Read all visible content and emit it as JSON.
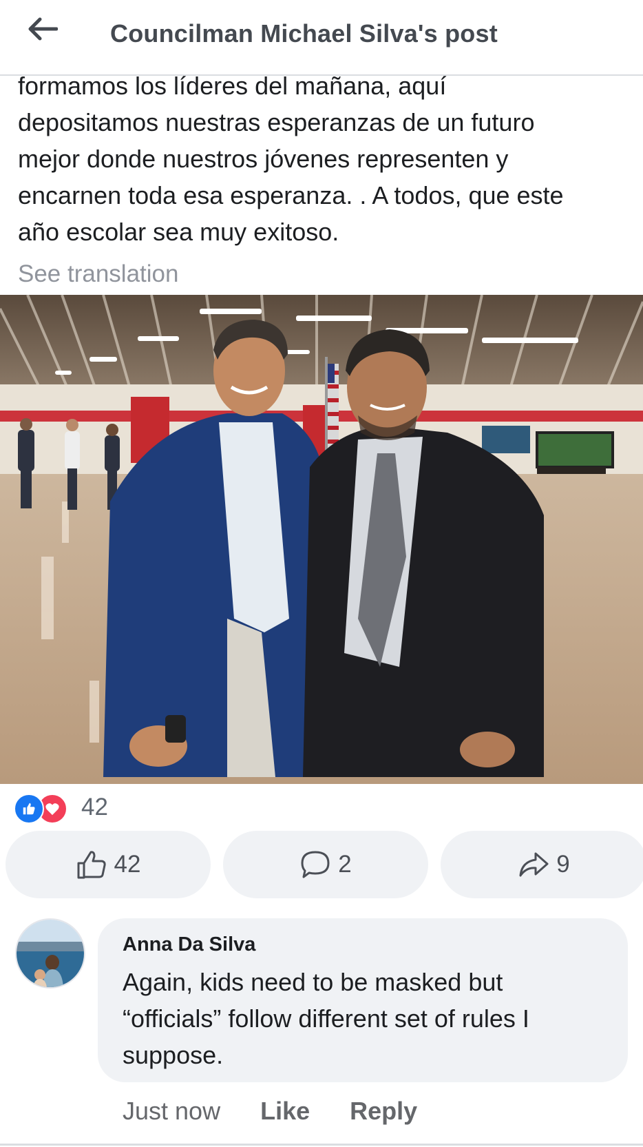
{
  "header": {
    "title": "Councilman Michael Silva's post",
    "back_icon": "arrow-left-icon"
  },
  "post": {
    "text_lines": [
      "formamos los líderes del mañana, aquí",
      "depositamos nuestras esperanzas de un futuro",
      "mejor donde nuestros jóvenes representen y",
      "encarnen toda esa esperanza. . A todos, que este",
      "año escolar sea muy exitoso."
    ],
    "see_translation": "See translation"
  },
  "reactions": {
    "icons": [
      "like-icon",
      "love-icon"
    ],
    "count": "42"
  },
  "actions": {
    "like_count": "42",
    "comment_count": "2",
    "share_count": "9"
  },
  "comment": {
    "author": "Anna Da Silva",
    "text_lines": [
      "Again, kids need to be masked but",
      "“officials” follow different set of rules I",
      "suppose."
    ],
    "time": "Just now",
    "like_label": "Like",
    "reply_label": "Reply"
  },
  "colors": {
    "like_blue": "#1877f2",
    "love_red": "#f33e58",
    "button_bg": "#f0f2f5",
    "muted_text": "#90949c"
  }
}
